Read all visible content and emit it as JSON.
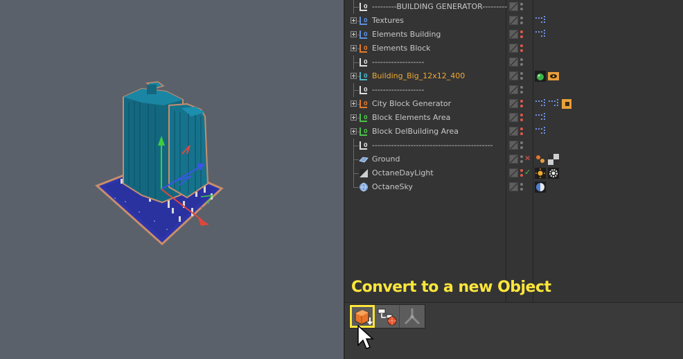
{
  "object_manager": {
    "rows": [
      {
        "name": "---------BUILDING GENERATOR---------",
        "expandable": false,
        "icon": "null-object-icon",
        "icon_color": "#dfdfdf",
        "active": false,
        "red_dot": false,
        "flag": "",
        "tags": []
      },
      {
        "name": "Textures",
        "expandable": true,
        "icon": "null-object-icon",
        "icon_color": "#5b8fde",
        "active": false,
        "red_dot": false,
        "flag": "",
        "tags": [
          "xpresso-icon"
        ]
      },
      {
        "name": "Elements Building",
        "expandable": true,
        "icon": "null-object-icon",
        "icon_color": "#5b8fde",
        "active": false,
        "red_dot": true,
        "flag": "",
        "tags": [
          "xpresso-icon"
        ]
      },
      {
        "name": "Elements Block",
        "expandable": true,
        "icon": "null-object-icon",
        "icon_color": "#e37a2a",
        "active": false,
        "red_dot": true,
        "flag": "",
        "tags": []
      },
      {
        "name": "-------------------",
        "expandable": false,
        "icon": "null-object-icon",
        "icon_color": "#dfdfdf",
        "active": false,
        "red_dot": false,
        "flag": "",
        "tags": []
      },
      {
        "name": "Building_Big_12x12_400",
        "expandable": true,
        "icon": "null-object-icon",
        "icon_color": "#4fb6c4",
        "active": true,
        "red_dot": false,
        "flag": "",
        "tags": [
          "phong-icon",
          "display-tag-icon"
        ]
      },
      {
        "name": "-------------------",
        "expandable": false,
        "icon": "null-object-icon",
        "icon_color": "#dfdfdf",
        "active": false,
        "red_dot": false,
        "flag": "",
        "tags": []
      },
      {
        "name": "City Block Generator",
        "expandable": true,
        "icon": "null-object-icon",
        "icon_color": "#e37a2a",
        "active": false,
        "red_dot": true,
        "flag": "",
        "tags": [
          "xpresso-icon",
          "xpresso-icon",
          "orange-tag-icon"
        ]
      },
      {
        "name": "Block Elements Area",
        "expandable": true,
        "icon": "null-object-icon",
        "icon_color": "#4cc24a",
        "active": false,
        "red_dot": true,
        "flag": "",
        "tags": [
          "xpresso-icon"
        ]
      },
      {
        "name": "Block DelBuilding Area",
        "expandable": true,
        "icon": "null-object-icon",
        "icon_color": "#4cc24a",
        "active": false,
        "red_dot": true,
        "flag": "",
        "tags": [
          "xpresso-icon"
        ]
      },
      {
        "name": "--------------------------------------------",
        "expandable": false,
        "icon": "null-object-icon",
        "icon_color": "#dfdfdf",
        "active": false,
        "red_dot": false,
        "flag": "",
        "tags": []
      },
      {
        "name": "Ground",
        "expandable": false,
        "icon": "plane-icon",
        "icon_color": "#7fa6d8",
        "active": false,
        "red_dot": false,
        "flag": "✕",
        "flag_color": "#e2584a",
        "tags": [
          "texture-tag-icon",
          "checker-tag-icon"
        ]
      },
      {
        "name": "OctaneDayLight",
        "expandable": false,
        "icon": "daylight-icon",
        "icon_color": "#cfcfcf",
        "active": false,
        "red_dot": true,
        "flag": "✓",
        "flag_color": "#4fc14f",
        "tags": [
          "sun-tag-icon",
          "light-tag-icon"
        ]
      },
      {
        "name": "OctaneSky",
        "expandable": false,
        "icon": "sky-icon",
        "icon_color": "#7fa6d8",
        "active": false,
        "red_dot": false,
        "flag": "",
        "tags": [
          "environment-tag-icon"
        ]
      }
    ]
  },
  "caption": "Convert to a new Object",
  "toolbar": {
    "buttons": [
      {
        "name": "convert-to-object-button",
        "icon": "convert-icon"
      },
      {
        "name": "connect-objects-button",
        "icon": "connect-icon"
      },
      {
        "name": "bone-tool-button",
        "icon": "joint-icon"
      }
    ]
  },
  "colors": {
    "caption": "#fde63b",
    "highlight_outline": "#fde63b",
    "viewport_bg": "#5b616a",
    "panel_bg": "#343434",
    "active_object": "#f0a934"
  }
}
